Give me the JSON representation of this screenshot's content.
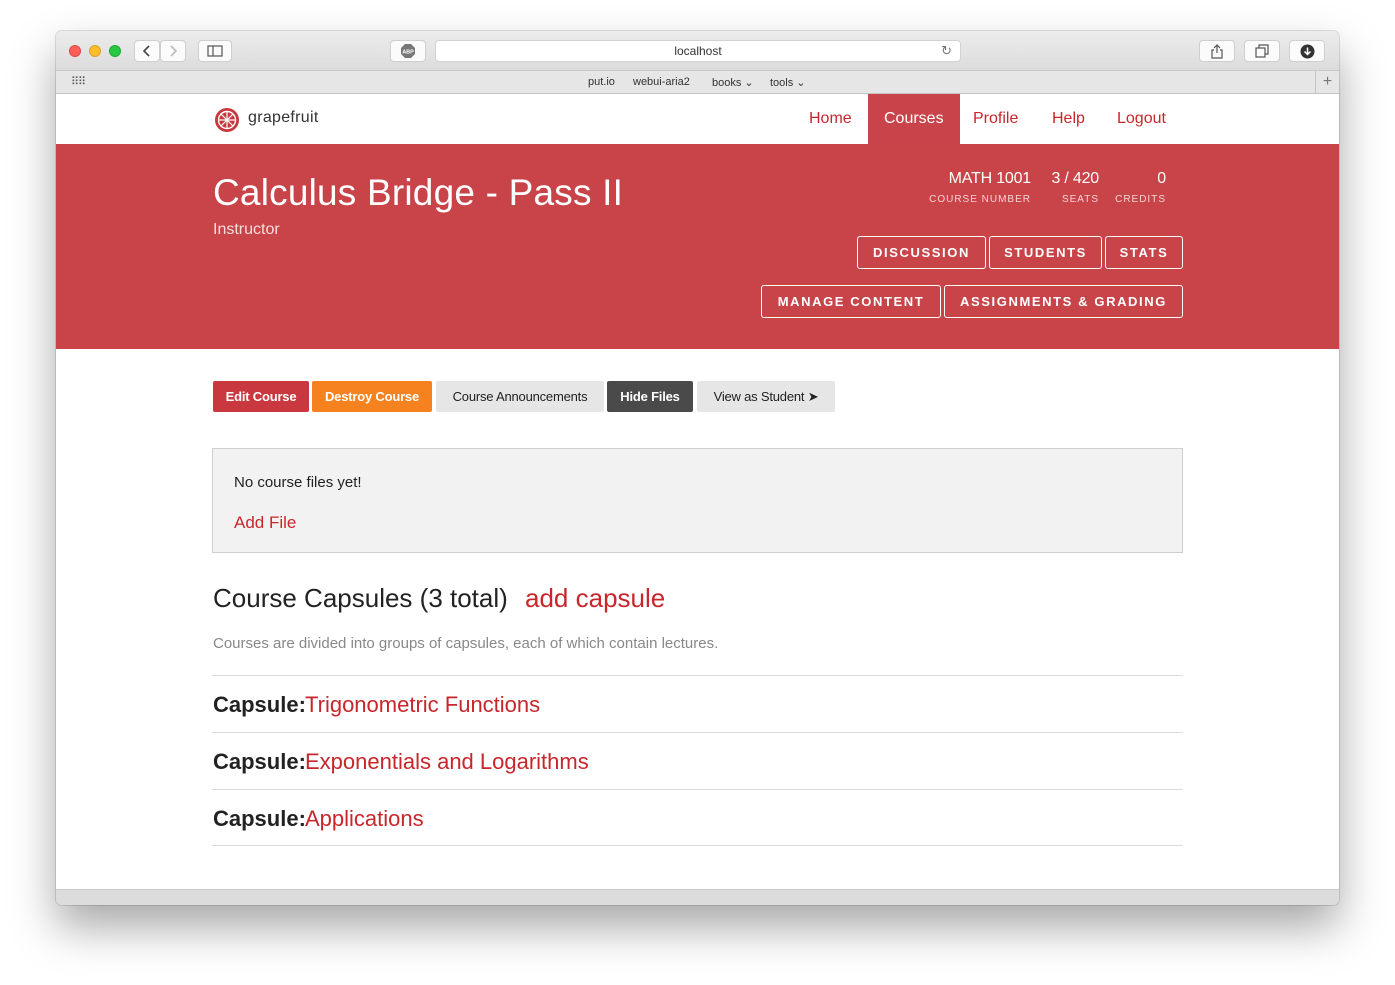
{
  "browser": {
    "url": "localhost",
    "bookmarks": [
      "put.io",
      "webui-aria2",
      "books ⌄",
      "tools ⌄"
    ],
    "icons": [
      "back-icon",
      "forward-icon",
      "sidebar-icon",
      "adblock-icon",
      "reload-icon",
      "share-icon",
      "tabs-icon",
      "download-icon"
    ],
    "adblock_label": "ABP"
  },
  "nav": {
    "brand": "grapefruit",
    "items": [
      "Home",
      "Courses",
      "Profile",
      "Help",
      "Logout"
    ],
    "active": "Courses",
    "accent": "#c7262b"
  },
  "hero": {
    "title": "Calculus Bridge - Pass II",
    "role": "Instructor",
    "background": "#c84449",
    "stats": [
      {
        "value": "MATH 1001",
        "label": "COURSE NUMBER"
      },
      {
        "value": "3 / 420",
        "label": "SEATS"
      },
      {
        "value": "0",
        "label": "CREDITS"
      }
    ],
    "buttons_row1": [
      "DISCUSSION",
      "STUDENTS",
      "STATS"
    ],
    "buttons_row2": [
      "MANAGE CONTENT",
      "ASSIGNMENTS & GRADING"
    ]
  },
  "actions": {
    "edit": "Edit Course",
    "destroy": "Destroy Course",
    "announcements": "Course Announcements",
    "hide_files": "Hide Files",
    "view_student": "View as Student ➤"
  },
  "files": {
    "empty_text": "No course files yet!",
    "add_link": "Add File"
  },
  "capsules": {
    "heading": "Course Capsules (3 total)",
    "add_link": "add capsule",
    "description": "Courses are divided into groups of capsules, each of which contain lectures.",
    "label": "Capsule:",
    "items": [
      "Trigonometric Functions",
      "Exponentials and Logarithms",
      "Applications"
    ]
  }
}
